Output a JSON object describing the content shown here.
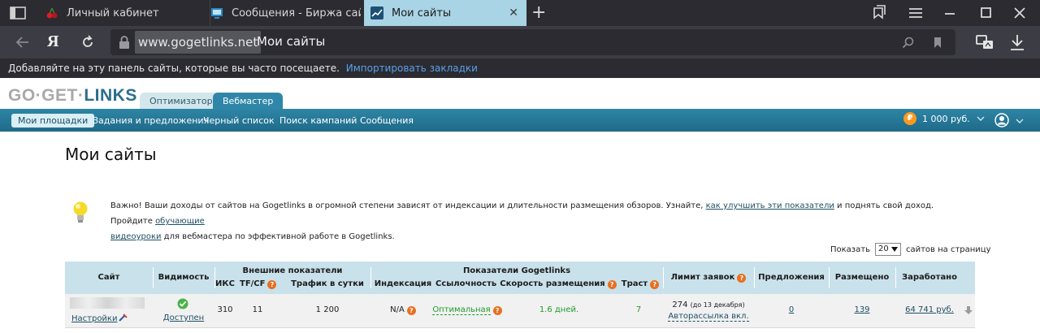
{
  "browser": {
    "tabs": [
      {
        "title": "Личный кабинет"
      },
      {
        "title": "Сообщения - Биржа сайто"
      },
      {
        "title": "Мои сайты"
      }
    ],
    "yandex_logo": "Я",
    "address": {
      "domain": "www.gogetlinks.net",
      "title": "Мои сайты"
    },
    "bookmarks_bar": {
      "text": "Добавляйте на эту панель сайты, которые вы часто посещаете.",
      "link": "Импортировать закладки"
    }
  },
  "site": {
    "logo": {
      "part1": "GO·GET·",
      "part2": "LINKS"
    },
    "role_tabs": {
      "optimizer": "Оптимизатор",
      "webmaster": "Вебмастер"
    },
    "nav": [
      "Мои площадки",
      "Задания и предложения",
      "Черный список",
      "Поиск кампаний",
      "Сообщения"
    ],
    "balance": {
      "currency_symbol": "₽",
      "amount": "1 000 руб."
    },
    "page_title": "Мои сайты",
    "tip": {
      "t1": "Важно! Ваши доходы от сайтов на Gogetlinks в огромной степени зависят от индексации и длительности размещения обзоров. Узнайте, ",
      "l1": "как улучшить эти показатели",
      "t2": " и поднять свой доход. Пройдите ",
      "l2a": "обучающие",
      "l2b": "видеоуроки",
      "t3": " для вебмастера по эффективной работе в Gogetlinks."
    },
    "per_page": {
      "label": "Показать",
      "value": "20",
      "suffix": "сайтов на страницу"
    }
  },
  "table": {
    "headers": {
      "site": "Сайт",
      "visibility": "Видимость",
      "external": "Внешние показатели",
      "iks": "ИКС",
      "tfcf": "TF/CF",
      "traffic": "Трафик в сутки",
      "ggl": "Показатели Gogetlinks",
      "indexing": "Индексация",
      "linking": "Ссылочность",
      "speed": "Скорость размещения",
      "trust": "Траст",
      "limit": "Лимит заявок",
      "offers": "Предложения",
      "placed": "Размещено",
      "earned": "Заработано"
    },
    "row": {
      "settings": "Настройки",
      "visibility": "Доступен",
      "iks": "310",
      "tfcf": "11",
      "traffic": "1 200",
      "indexing": "N/A",
      "linking": "Оптимальная",
      "speed": "1.6 дней.",
      "trust": "7",
      "limit": "274",
      "limit_date": "(до 13 декабря)",
      "autosend": "Авторассылка вкл.",
      "offers": "0",
      "placed": "139",
      "earned": "64 741 руб."
    }
  }
}
